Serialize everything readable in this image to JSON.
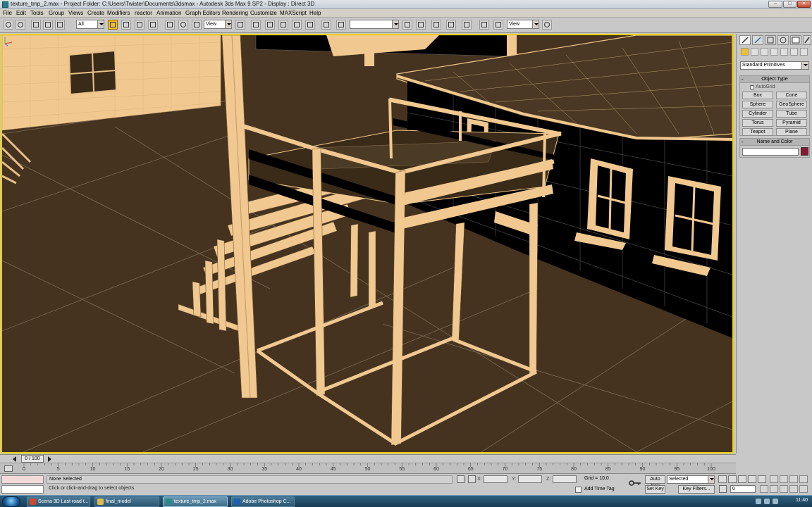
{
  "window": {
    "title": "texture_tmp_2.max    -   Project Folder: C:\\Users\\Twister\\Documents\\3dsmax    -   Autodesk 3ds Max 9 SP2    -   Display : Direct 3D",
    "minimize": "–",
    "maximize": "□",
    "close": "✕"
  },
  "menu": [
    "File",
    "Edit",
    "Tools",
    "Group",
    "Views",
    "Create",
    "Modifiers",
    "reactor",
    "Animation",
    "Graph Editors",
    "Rendering",
    "Customize",
    "MAXScript",
    "Help"
  ],
  "toolbar": {
    "selection_filter": "All",
    "reference_coord": "View",
    "named_selection": "",
    "coord_system_2": "View"
  },
  "command_panel": {
    "category": "Standard Primitives",
    "object_type_title": "Object Type",
    "autogrid": "AutoGrid",
    "object_buttons": [
      "Box",
      "Cone",
      "Sphere",
      "GeoSphere",
      "Cylinder",
      "Tube",
      "Torus",
      "Pyramid",
      "Teapot",
      "Plane"
    ],
    "name_color_title": "Name and Color",
    "name_value": "",
    "object_color": "#8a1638"
  },
  "timeline": {
    "slider_label": "0 / 100",
    "ticks": [
      "0",
      "5",
      "10",
      "15",
      "20",
      "25",
      "30",
      "35",
      "40",
      "45",
      "50",
      "55",
      "60",
      "65",
      "70",
      "75",
      "80",
      "85",
      "90",
      "95",
      "100"
    ]
  },
  "status": {
    "selection": "None Selected",
    "prompt": "Click or click-and-drag to select objects",
    "x_label": "X:",
    "y_label": "Y:",
    "z_label": "Z:",
    "grid": "Grid = 10,0",
    "add_time_tag": "Add Time Tag",
    "auto_key": "Auto Key",
    "set_key": "Set Key",
    "key_mode": "Selected",
    "key_filters": "Key Filters...",
    "frame": "0"
  },
  "taskbar": {
    "tasks": [
      {
        "label": "Scena 3D Last road t...",
        "color": "#d04a2a"
      },
      {
        "label": "final_model",
        "color": "#e2b84a"
      },
      {
        "label": "texture_tmp_2.max",
        "color": "#2b8a8a"
      },
      {
        "label": "Adobe Photoshop C...",
        "color": "#1e5fb3"
      }
    ],
    "clock": "11:40"
  },
  "colors": {
    "viewport_bg": "#453320",
    "viewport_border": "#f0d000",
    "wire": "#f0c88c"
  }
}
